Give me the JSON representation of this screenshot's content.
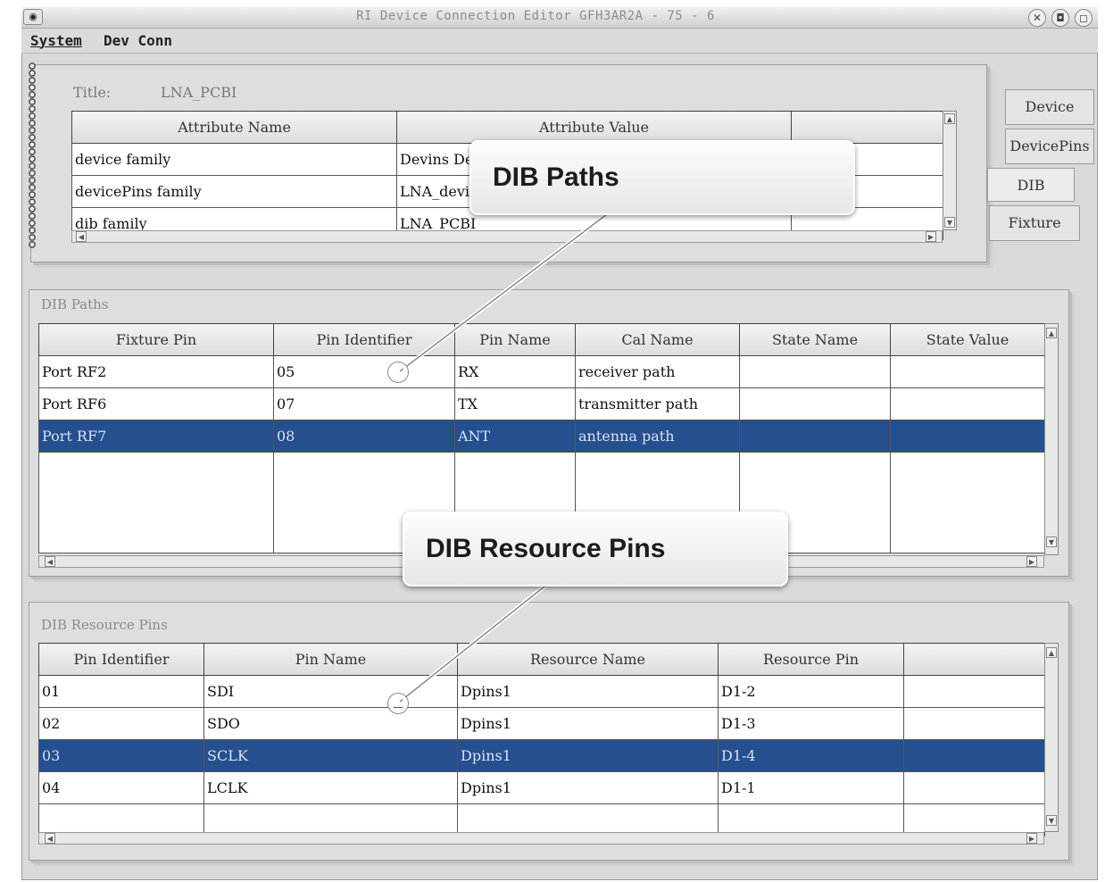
{
  "window": {
    "title": "RI Device Connection Editor GFH3AR2A - 75 - 6",
    "buttons": {
      "close": "✕",
      "minimize": "◘",
      "maximize": "◻"
    }
  },
  "menubar": [
    {
      "label": "System"
    },
    {
      "label": "Dev Conn"
    }
  ],
  "attributes": {
    "title_label": "Title:",
    "title_value": "LNA_PCBI",
    "columns": [
      "Attribute Name",
      "Attribute Value",
      ""
    ],
    "rows": [
      {
        "name": "device family",
        "value": "Devins Dev"
      },
      {
        "name": "devicePins family",
        "value": "LNA_devi"
      },
      {
        "name": "dib family",
        "value": "LNA_PCBI"
      }
    ]
  },
  "tabs": [
    "Device",
    "DevicePins",
    "DIB",
    "Fixture"
  ],
  "dib_paths": {
    "title": "DIB Paths",
    "columns": [
      "Fixture Pin",
      "Pin Identifier",
      "Pin Name",
      "Cal Name",
      "State Name",
      "State Value"
    ],
    "rows": [
      {
        "fixture_pin": "Port RF2",
        "pin_identifier": "05",
        "pin_name": "RX",
        "cal_name": "receiver path",
        "state_name": "",
        "state_value": "",
        "selected": false
      },
      {
        "fixture_pin": "Port RF6",
        "pin_identifier": "07",
        "pin_name": "TX",
        "cal_name": "transmitter path",
        "state_name": "",
        "state_value": "",
        "selected": false
      },
      {
        "fixture_pin": "Port RF7",
        "pin_identifier": "08",
        "pin_name": "ANT",
        "cal_name": "antenna path",
        "state_name": "",
        "state_value": "",
        "selected": true
      }
    ]
  },
  "dib_resource_pins": {
    "title": "DIB Resource Pins",
    "columns": [
      "Pin Identifier",
      "Pin Name",
      "Resource Name",
      "Resource Pin",
      ""
    ],
    "rows": [
      {
        "pin_identifier": "01",
        "pin_name": "SDI",
        "resource_name": "Dpins1",
        "resource_pin": "D1-2",
        "selected": false
      },
      {
        "pin_identifier": "02",
        "pin_name": "SDO",
        "resource_name": "Dpins1",
        "resource_pin": "D1-3",
        "selected": false
      },
      {
        "pin_identifier": "03",
        "pin_name": "SCLK",
        "resource_name": "Dpins1",
        "resource_pin": "D1-4",
        "selected": true
      },
      {
        "pin_identifier": "04",
        "pin_name": "LCLK",
        "resource_name": "Dpins1",
        "resource_pin": "D1-1",
        "selected": false
      }
    ]
  },
  "callouts": {
    "dib_paths": "DIB Paths",
    "dib_resource_pins": "DIB Resource Pins"
  },
  "colors": {
    "selection": "#254f8e",
    "selection_text": "#d8e2f2",
    "panel": "#dedede"
  }
}
